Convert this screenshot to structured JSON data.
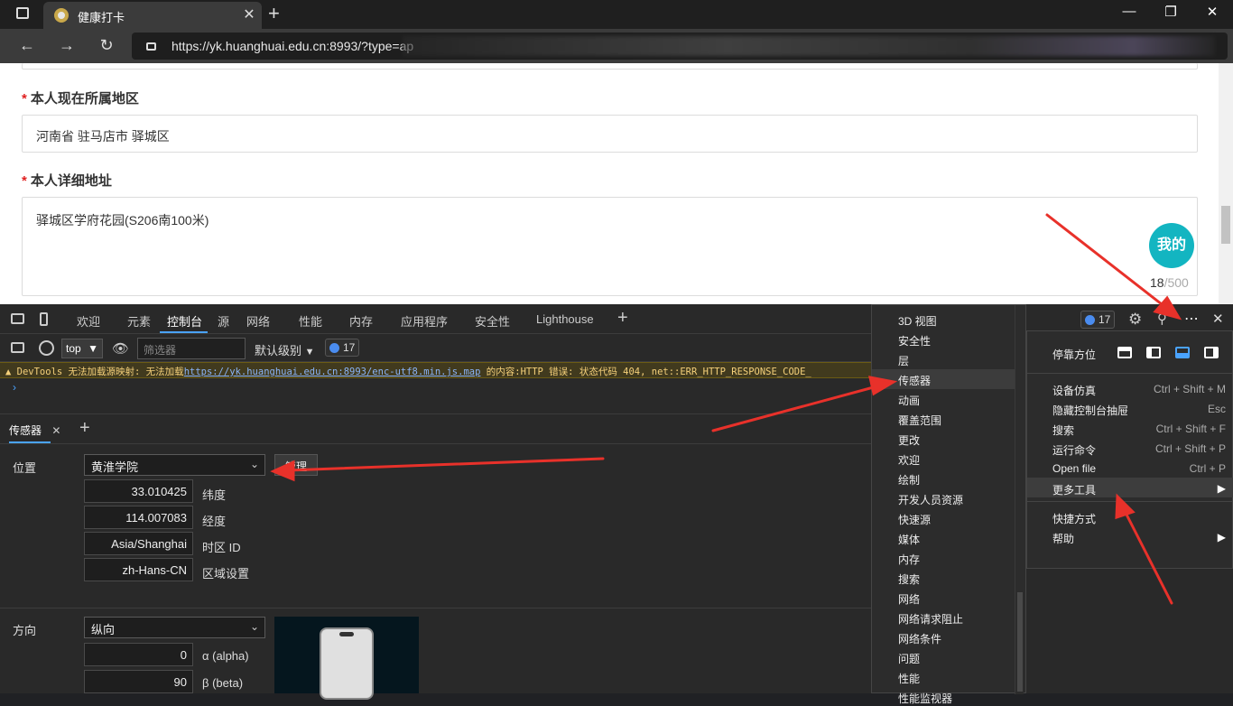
{
  "browser": {
    "tab_title": "健康打卡",
    "tab_close": "✕",
    "new_tab": "+",
    "url": "https://yk.huanghuai.edu.cn:8993/?type=ap"
  },
  "page": {
    "field_region_label": "本人现在所属地区",
    "field_region_value": "河南省 驻马店市 驿城区",
    "field_address_label": "本人详细地址",
    "field_address_value": "驿城区学府花园(S206南100米)",
    "required_mark": "*",
    "mine_button": "我的",
    "char_count": "18",
    "char_max": "/500"
  },
  "devtools": {
    "tabs": [
      "欢迎",
      "元素",
      "控制台",
      "源",
      "网络",
      "性能",
      "内存",
      "应用程序",
      "安全性",
      "Lighthouse"
    ],
    "active_tab": "控制台",
    "add_tab": "+",
    "issues_count": "17",
    "console": {
      "context": "top",
      "filter_placeholder": "筛选器",
      "level": "默认级别",
      "issues_count": "17",
      "warning_prefix": "▲ DevTools 无法加载源映射: 无法加载",
      "warning_link": "https://yk.huanghuai.edu.cn:8993/enc-utf8.min.js.map",
      "warning_suffix": " 的内容:HTTP 错误: 状态代码 404, net::ERR_HTTP_RESPONSE_CODE_",
      "prompt": "›"
    },
    "drawer": {
      "tab": "传感器",
      "close": "✕",
      "add": "+"
    },
    "sensors": {
      "location_label": "位置",
      "location_value": "黄淮学院",
      "manage_button": "管理",
      "latitude": "33.010425",
      "latitude_label": "纬度",
      "longitude": "114.007083",
      "longitude_label": "经度",
      "timezone": "Asia/Shanghai",
      "timezone_label": "时区 ID",
      "locale": "zh-Hans-CN",
      "locale_label": "区域设置",
      "orientation_label": "方向",
      "orientation_value": "纵向",
      "alpha": "0",
      "alpha_label": "α (alpha)",
      "beta": "90",
      "beta_label": "β (beta)"
    }
  },
  "more_tools_menu": {
    "items": [
      "3D 视图",
      "安全性",
      "层",
      "传感器",
      "动画",
      "覆盖范围",
      "更改",
      "欢迎",
      "绘制",
      "开发人员资源",
      "快速源",
      "媒体",
      "内存",
      "搜索",
      "网络",
      "网络请求阻止",
      "网络条件",
      "问题",
      "性能",
      "性能监视器"
    ],
    "highlighted": "传感器"
  },
  "main_menu": {
    "dock_label": "停靠方位",
    "items": [
      {
        "label": "设备仿真",
        "shortcut": "Ctrl + Shift + M"
      },
      {
        "label": "隐藏控制台抽屉",
        "shortcut": "Esc"
      },
      {
        "label": "搜索",
        "shortcut": "Ctrl + Shift + F"
      },
      {
        "label": "运行命令",
        "shortcut": "Ctrl + Shift + P"
      },
      {
        "label": "Open file",
        "shortcut": "Ctrl + P"
      },
      {
        "label": "更多工具",
        "shortcut": "▶"
      },
      {
        "label": "快捷方式",
        "shortcut": ""
      },
      {
        "label": "帮助",
        "shortcut": "▶"
      }
    ]
  },
  "colors": {
    "accent": "#4aa3ff",
    "annotation_arrow": "#e8312a",
    "mine_button": "#13b5c1"
  }
}
